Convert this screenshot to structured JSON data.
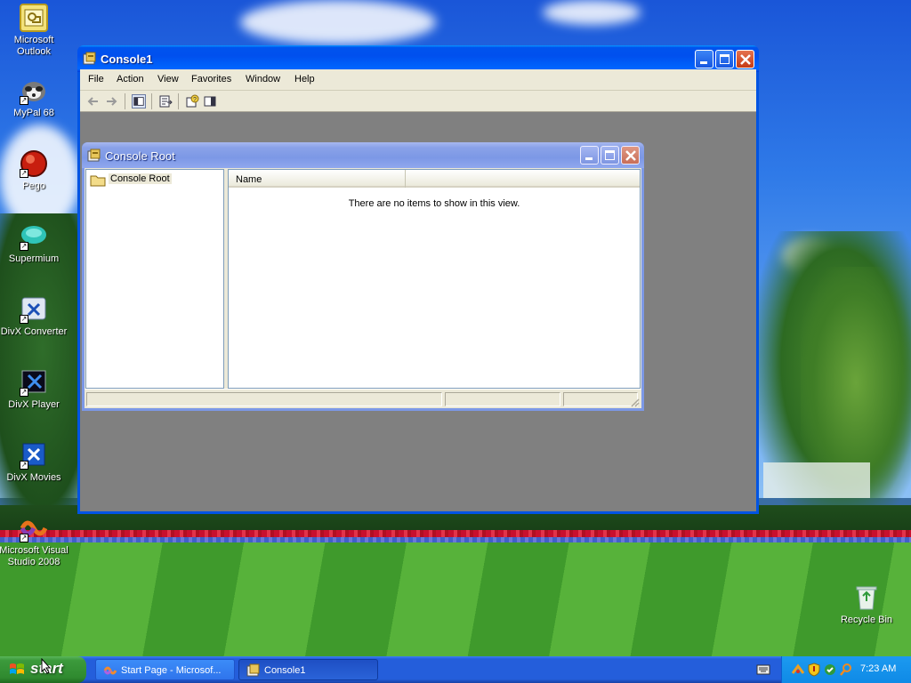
{
  "desktop": {
    "icons": [
      {
        "label": "Microsoft Outlook",
        "icon": "outlook-icon"
      },
      {
        "label": "MyPal 68",
        "icon": "mypal-icon"
      },
      {
        "label": "Pego",
        "icon": "pego-icon"
      },
      {
        "label": "Supermium",
        "icon": "supermium-icon"
      },
      {
        "label": "DivX Converter",
        "icon": "divx-converter-icon"
      },
      {
        "label": "DivX Player",
        "icon": "divx-player-icon"
      },
      {
        "label": "DivX Movies",
        "icon": "divx-movies-icon"
      },
      {
        "label": "Microsoft Visual Studio 2008",
        "icon": "visual-studio-icon"
      },
      {
        "label": "Recycle Bin",
        "icon": "recycle-bin-icon"
      }
    ]
  },
  "console_window": {
    "title": "Console1",
    "menu": [
      "File",
      "Action",
      "View",
      "Favorites",
      "Window",
      "Help"
    ],
    "toolbar": [
      "back-arrow-icon",
      "forward-arrow-icon",
      "show-hide-tree-icon",
      "export-list-icon",
      "help-icon",
      "show-hide-action-pane-icon"
    ]
  },
  "console_root_window": {
    "title": "Console Root",
    "tree_root": "Console Root",
    "column_name": "Name",
    "empty_message": "There are no items to show in this view."
  },
  "taskbar": {
    "start_label": "start",
    "tasks": [
      {
        "label": "Start Page - Microsof...",
        "active": false
      },
      {
        "label": "Console1",
        "active": true
      }
    ],
    "clock": "7:23 AM"
  },
  "colors": {
    "xp_blue": "#0054e3",
    "start_green": "#3c9a3c",
    "window_face": "#ece9d8",
    "mdi_background": "#808080"
  }
}
